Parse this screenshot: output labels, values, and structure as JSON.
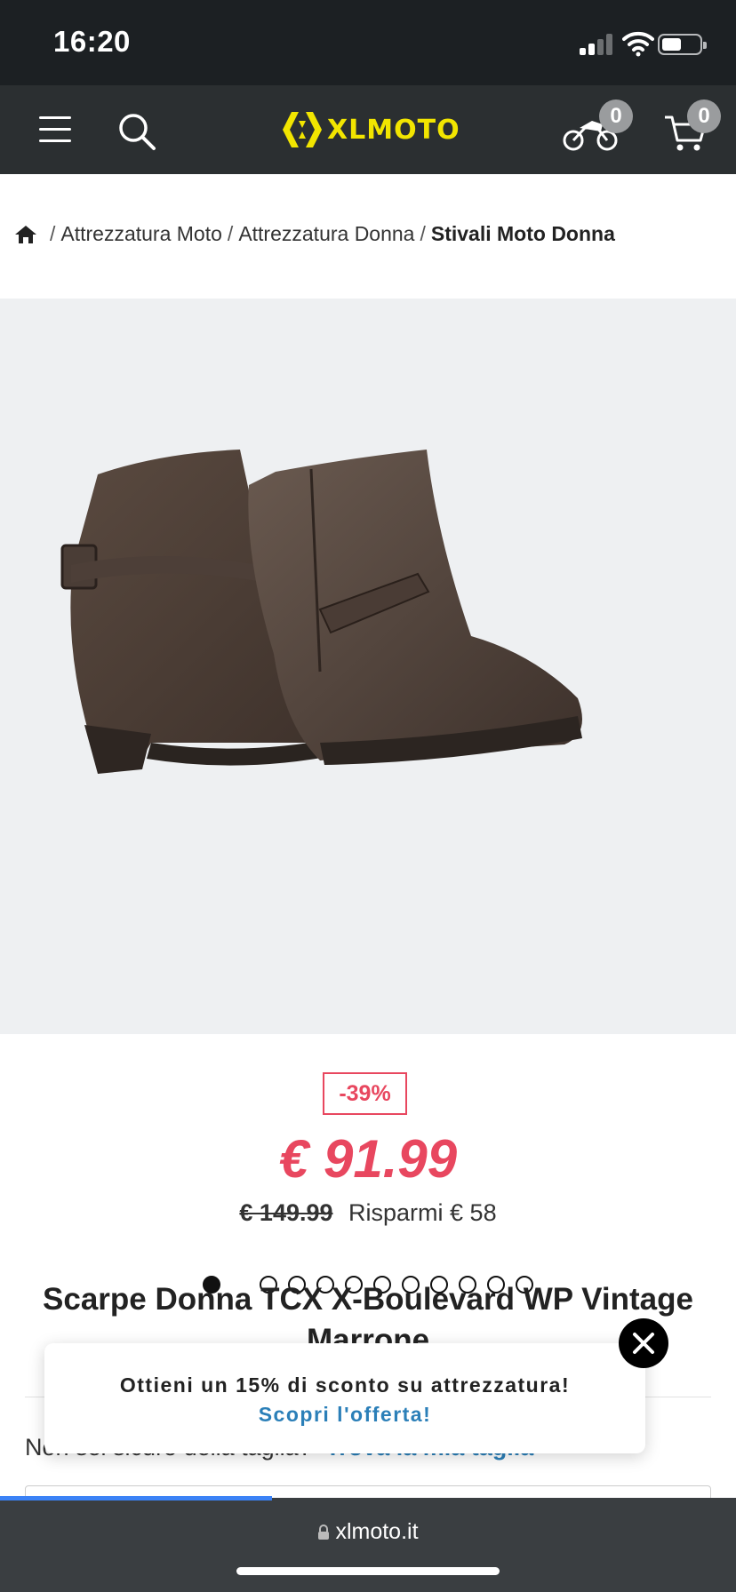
{
  "status_bar": {
    "time": "16:20"
  },
  "header": {
    "logo_text": "XLMOTO",
    "garage_count": "0",
    "cart_count": "0",
    "brand_yellow": "#f2e500",
    "icons": [
      "menu-icon",
      "search-icon",
      "motorcycle-icon",
      "cart-icon"
    ]
  },
  "breadcrumb": {
    "items": [
      "Attrezzatura Moto",
      "Attrezzatura Donna"
    ],
    "current": "Stivali Moto Donna",
    "separator": "/"
  },
  "gallery": {
    "total_dots": 12,
    "active_index": 0,
    "video_index": 1
  },
  "product": {
    "discount": "-39%",
    "price": "€ 91.99",
    "old_price": "€ 149.99",
    "savings": "Risparmi € 58",
    "title": "Scarpe Donna TCX X-Boulevard WP Vintage Marrone",
    "accent_color": "#e8475f"
  },
  "size_help": {
    "question": "Non sei sicuro della taglia?",
    "link": "Trova la mia taglia"
  },
  "promo": {
    "line1": "Ottieni un 15% di sconto su attrezzatura!",
    "line2": "Scopri l'offerta!",
    "link_color": "#2b7fb8"
  },
  "browser": {
    "url": "xlmoto.it",
    "load_progress": 0.37
  }
}
